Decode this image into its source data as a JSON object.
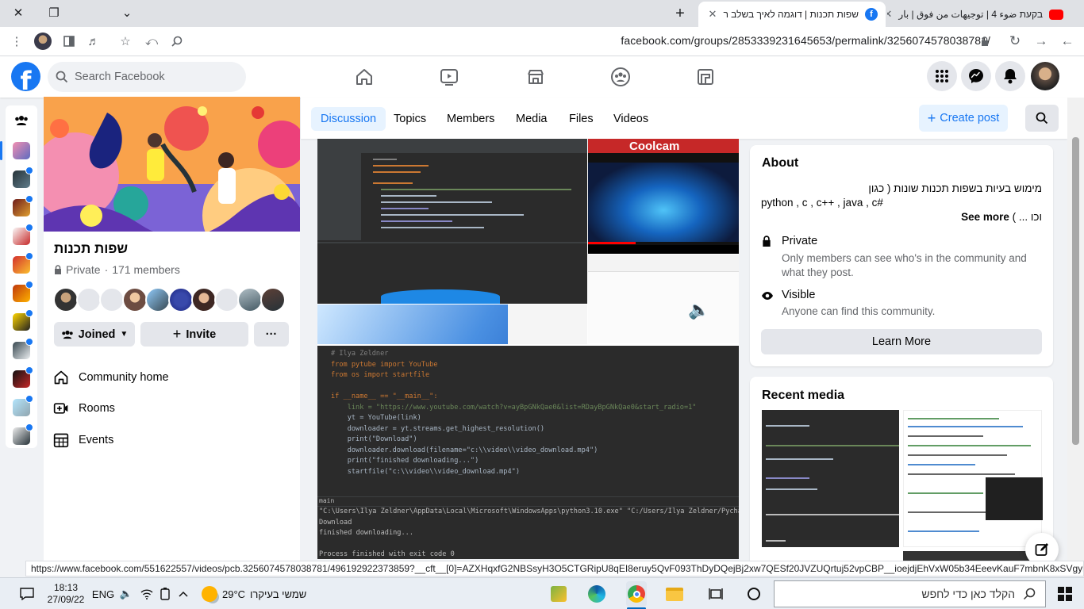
{
  "browser": {
    "tabs": [
      {
        "title": "שפות תכנות | דוגמה לאיך בשלב ר",
        "active": true
      },
      {
        "title": "בקעת ضوء 4 | توجيهات من فوق | بار",
        "active": false
      }
    ],
    "url": "facebook.com/groups/2853339231645653/permalink/3256074578038781/"
  },
  "facebook": {
    "search_placeholder": "Search Facebook"
  },
  "group": {
    "name": "שפות תכנות",
    "privacy": "Private",
    "members_count": "171 members",
    "joined_label": "Joined",
    "invite_label": "Invite",
    "more_label": "···",
    "nav": [
      {
        "label": "Community home",
        "icon": "home-icon"
      },
      {
        "label": "Rooms",
        "icon": "rooms-icon"
      },
      {
        "label": "Events",
        "icon": "calendar-icon"
      }
    ]
  },
  "tabs": [
    "Discussion",
    "Topics",
    "Members",
    "Media",
    "Files",
    "Videos"
  ],
  "create_post_label": "Create post",
  "post": {
    "video_brand": "Coolcam",
    "code_lines": [
      "# Ilya Zeldner",
      "from pytube import YouTube",
      "from os import startfile",
      "",
      "if __name__ == \"__main__\":",
      "    link = \"https://www.youtube.com/watch?v=ayBpGNkQae0&list=RDayBpGNkQae0&start_radio=1\"",
      "    yt = YouTube(link)",
      "    downloader = yt.streams.get_highest_resolution()",
      "    print(\"Download\")",
      "    downloader.download(filename=\"c:\\\\video\\\\video_download.mp4\")",
      "    print(\"finished downloading...\")",
      "    startfile(\"c:\\\\video\\\\video_download.mp4\")"
    ],
    "run_tab": "main",
    "console_lines": [
      "\"C:\\Users\\Ilya Zeldner\\AppData\\Local\\Microsoft\\WindowsApps\\python3.10.exe\" \"C:/Users/Ilya Zeldner/PycharmProj",
      "Download",
      "finished downloading...",
      "",
      "Process finished with exit code 0"
    ]
  },
  "about": {
    "title": "About",
    "desc_line1": "מימוש בעיות בשפות תכנות שונות ( כגון",
    "desc_line2": "python , c , c++ , java , c#",
    "desc_line3": "וכו ... )",
    "see_more": "See more",
    "private_title": "Private",
    "private_desc": "Only members can see who's in the community and what they post.",
    "visible_title": "Visible",
    "visible_desc": "Anyone can find this community.",
    "learn_more": "Learn More"
  },
  "recent_media_title": "Recent media",
  "status_url": "https://www.facebook.com/551622557/videos/pcb.3256074578038781/496192922373859?__cft__[0]=AZXHqxfG2NBSsyH3O5CTGRipU8qEI8eruy5QvF093ThDyDQejBj2xw7QESf20JVZUQrtuj52vpCBP__ioejdjEhVxW05b34EeevKauF7mbnK8xSVgybqbqC...",
  "taskbar": {
    "time": "18:13",
    "date": "27/09/22",
    "lang": "ENG",
    "weather_temp": "29°C",
    "weather_text": "שמשי בעיקרו",
    "search_placeholder": "הקלד כאן כדי לחפש"
  }
}
